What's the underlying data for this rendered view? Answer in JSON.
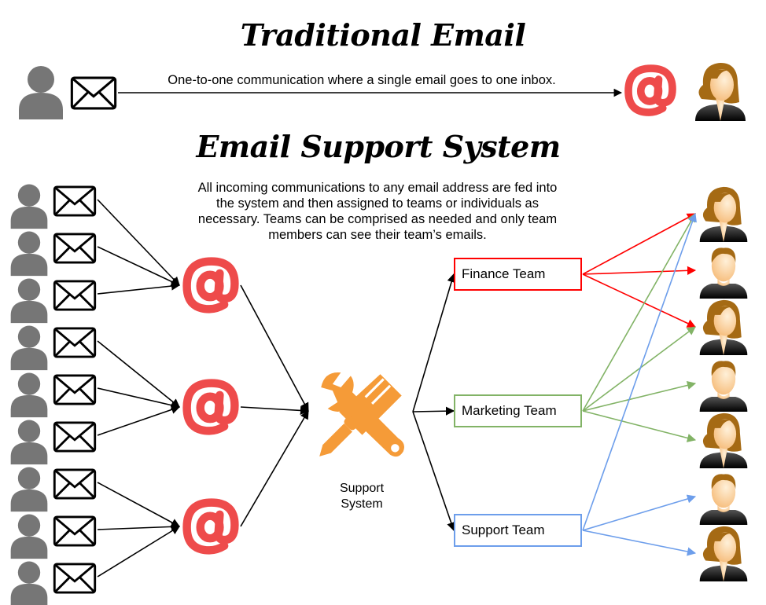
{
  "traditional": {
    "title": "Traditional Email",
    "description": "One-to-one communication where a single email goes to one inbox.",
    "sender_icon": "user-silhouette-icon",
    "message_icon": "envelope-icon",
    "inbox_icon": "at-sign-icon",
    "recipient_icon": "female-user-icon"
  },
  "support_system": {
    "title": "Email Support System",
    "description_lines": [
      "All incoming communications to any email address are fed into",
      "the system and then assigned to teams or individuals as",
      "necessary. Teams can be comprised as needed and only team",
      "members can see their team’s emails."
    ],
    "hub_label_line1": "Support",
    "hub_label_line2": "System",
    "hub_icon": "wrench-screwdriver-icon",
    "senders": 9,
    "inboxes": 3,
    "teams": [
      {
        "name": "Finance Team",
        "color": "#ff0000",
        "recipients": [
          1,
          2,
          3
        ]
      },
      {
        "name": "Marketing Team",
        "color": "#82b366",
        "recipients": [
          1,
          3,
          4,
          5
        ]
      },
      {
        "name": "Support Team",
        "color": "#6d9eeb",
        "recipients": [
          1,
          6,
          7
        ]
      }
    ],
    "recipients": [
      "female",
      "male",
      "female",
      "male",
      "female",
      "male",
      "female"
    ]
  },
  "colors": {
    "at_sign": "#ee4b4b",
    "person_gray": "#767676",
    "tool_orange": "#f59b38",
    "hair_brown": "#a56a14",
    "skin": "#fcd3a0"
  }
}
